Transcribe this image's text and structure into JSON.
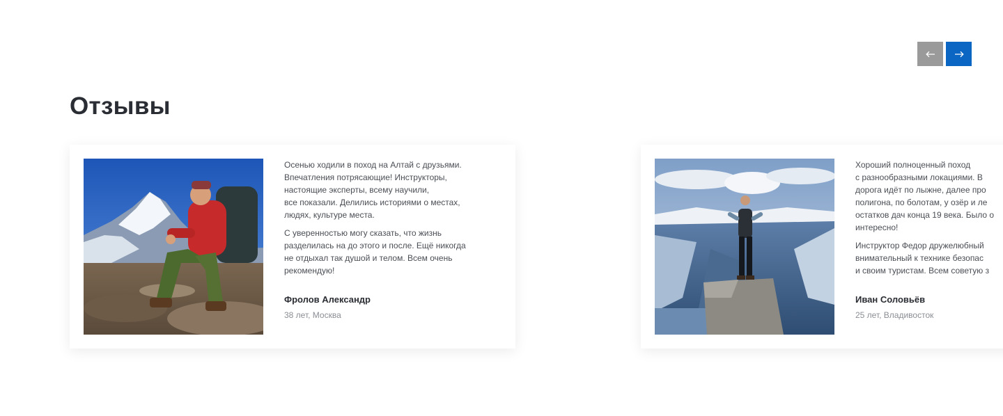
{
  "section": {
    "title": "Отзывы"
  },
  "nav": {
    "prev_icon": "arrow-left-icon",
    "next_icon": "arrow-right-icon",
    "prev_color": "#9a9a9a",
    "next_color": "#0a66c2"
  },
  "reviews": [
    {
      "paragraph_1": "Осенью ходили в поход на Алтай с друзьями.\nВпечатления потрясающие! Инструкторы,\nнастоящие эксперты, всему научили,\nвсе показали. Делились историями о местах,\nлюдях, культуре места.",
      "paragraph_2": "С уверенностью могу сказать, что жизнь\nразделилась на до этого и после. Ещё никогда\nне отдыхал так душой и телом. Всем очень\nрекомендую!",
      "author": "Фролов Александр",
      "meta": "38 лет, Москва",
      "photo": "hiker-sitting-mountains-photo"
    },
    {
      "paragraph_1": "Хороший полноценный поход\nс разнообразными локациями. В\nдорога идёт по лыжне, далее про\nполигона, по болотам, у озёр и ле\nостатков дач конца 19 века. Было о\nинтересно!",
      "paragraph_2": "Инструктор Федор дружелюбный\nвнимательный к технике безопас\nи своим туристам. Всем советую з",
      "author": "Иван Соловьёв",
      "meta": "25 лет, Владивосток",
      "photo": "hiker-standing-cliff-photo"
    }
  ]
}
